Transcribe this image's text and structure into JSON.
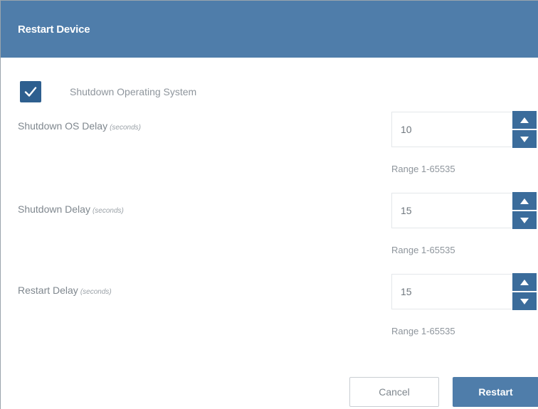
{
  "dialog": {
    "title": "Restart Device"
  },
  "shutdown_os": {
    "checked": true,
    "label": "Shutdown Operating System"
  },
  "fields": [
    {
      "label": "Shutdown OS Delay",
      "unit": "(seconds)",
      "value": "10",
      "range": "Range 1-65535"
    },
    {
      "label": "Shutdown Delay",
      "unit": "(seconds)",
      "value": "15",
      "range": "Range 1-65535"
    },
    {
      "label": "Restart Delay",
      "unit": "(seconds)",
      "value": "15",
      "range": "Range 1-65535"
    }
  ],
  "buttons": {
    "cancel": "Cancel",
    "restart": "Restart"
  },
  "colors": {
    "titlebar": "#4f7daa",
    "checkbox": "#2e5f8f",
    "spinner": "#3b6c9b",
    "primary_button": "#4f7daa"
  },
  "icons": {
    "checkbox": "check-icon",
    "spinner_up": "chevron-up-icon",
    "spinner_down": "chevron-down-icon"
  }
}
